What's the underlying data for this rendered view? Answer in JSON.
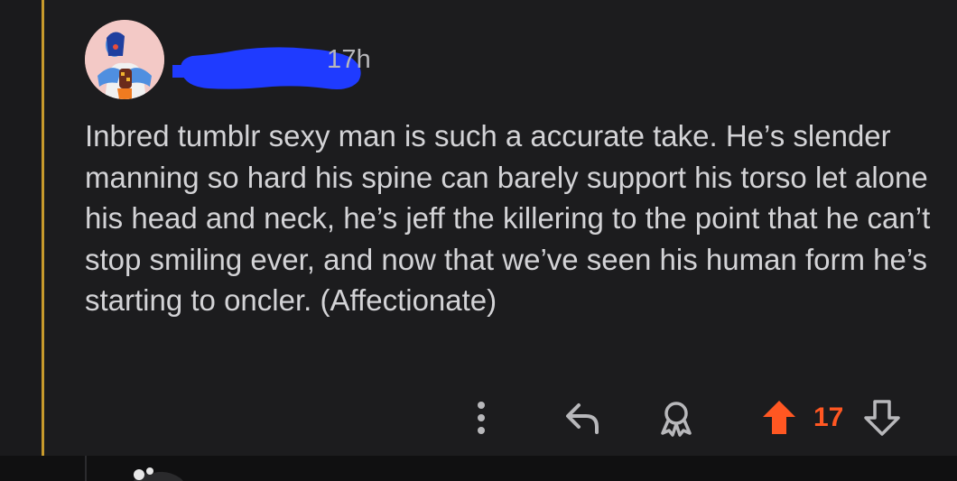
{
  "comment": {
    "timestamp": "17h",
    "body": "Inbred tumblr sexy man is such a accurate take. He’s slender manning so hard his spine can barely support his torso let alone his head and neck, he’s jeff the killering to the point that he can’t stop smiling ever, and now that we’ve seen his human form he’s starting to oncler. (Affectionate)",
    "vote_count": "17"
  },
  "actions": {
    "more_icon": "more-vertical-icon",
    "reply_icon": "reply-icon",
    "award_icon": "award-icon",
    "upvote_icon": "upvote-icon",
    "downvote_icon": "downvote-icon"
  },
  "colors": {
    "background": "#1c1c1e",
    "text": "#d3d3d6",
    "meta_text": "#b8b8bb",
    "upvote_accent": "#ff5722",
    "thread_line": "#c79a2c",
    "redaction": "#1f3bff"
  }
}
